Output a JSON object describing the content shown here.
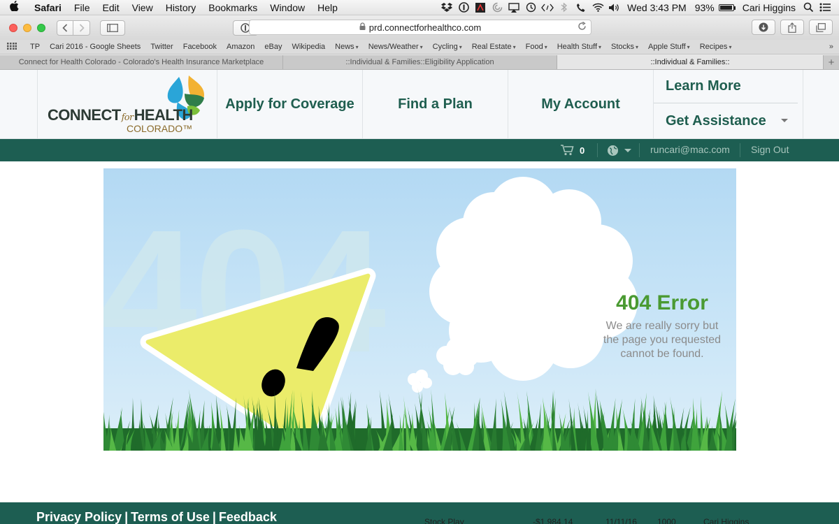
{
  "menubar": {
    "app": "Safari",
    "menus": [
      "File",
      "Edit",
      "View",
      "History",
      "Bookmarks",
      "Window",
      "Help"
    ],
    "clock": "Wed 3:43 PM",
    "battery": "93%",
    "user": "Cari Higgins"
  },
  "browser": {
    "url": "prd.connectforhealthco.com",
    "favorites": [
      {
        "label": "TP",
        "menu": false
      },
      {
        "label": "Cari 2016 - Google Sheets",
        "menu": false
      },
      {
        "label": "Twitter",
        "menu": false
      },
      {
        "label": "Facebook",
        "menu": false
      },
      {
        "label": "Amazon",
        "menu": false
      },
      {
        "label": "eBay",
        "menu": false
      },
      {
        "label": "Wikipedia",
        "menu": false
      },
      {
        "label": "News",
        "menu": true
      },
      {
        "label": "News/Weather",
        "menu": true
      },
      {
        "label": "Cycling",
        "menu": true
      },
      {
        "label": "Real Estate",
        "menu": true
      },
      {
        "label": "Food",
        "menu": true
      },
      {
        "label": "Health Stuff",
        "menu": true
      },
      {
        "label": "Stocks",
        "menu": true
      },
      {
        "label": "Apple Stuff",
        "menu": true
      },
      {
        "label": "Recipes",
        "menu": true
      }
    ],
    "tabs": [
      {
        "title": "Connect for Health Colorado - Colorado's Health Insurance Marketplace",
        "active": false
      },
      {
        "title": "::Individual & Families::Eligibility Application",
        "active": false
      },
      {
        "title": "::Individual & Families::",
        "active": true
      }
    ]
  },
  "site": {
    "logo": {
      "word1": "CONNECT",
      "word2": "for",
      "word3": "HEALTH",
      "sub": "COLORADO™"
    },
    "nav": [
      "Apply for Coverage",
      "Find a Plan",
      "My Account"
    ],
    "side_nav": [
      "Learn More",
      "Get Assistance"
    ],
    "account_bar": {
      "cart_count": "0",
      "email": "runcari@mac.com",
      "signout": "Sign Out"
    },
    "error": {
      "bg_digits": "404",
      "title": "404 Error",
      "message": "We are really sorry but the page you requested cannot be found."
    },
    "footer_links": [
      "Privacy Policy",
      "Terms of Use",
      "Feedback"
    ],
    "behind_window_text": [
      "Stock Play",
      "-$1,984.14",
      "11/11/16",
      "1000",
      "Cari Higgins"
    ]
  }
}
